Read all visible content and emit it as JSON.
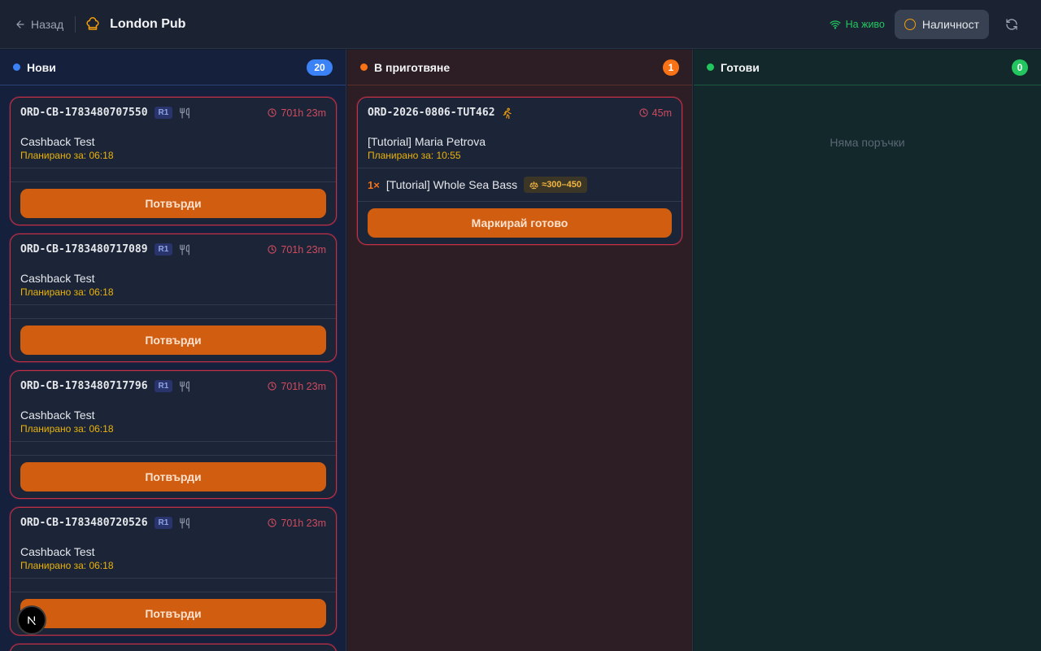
{
  "header": {
    "back_label": "Назад",
    "title": "London Pub",
    "live_label": "На живо",
    "availability_label": "Наличност"
  },
  "colors": {
    "new_dot": "#3b82f6",
    "prep_dot": "#f97316",
    "ready_dot": "#22c55e",
    "accent_button": "#d05d10",
    "urgent_border": "#c53047"
  },
  "columns": {
    "new": {
      "title": "Нови",
      "count": "20",
      "orders": [
        {
          "id": "ORD-CB-1783480707550",
          "branch": "R1",
          "elapsed": "701h 23m",
          "name": "Cashback Test",
          "scheduled": "Планирано за: 06:18",
          "action": "Потвърди"
        },
        {
          "id": "ORD-CB-1783480717089",
          "branch": "R1",
          "elapsed": "701h 23m",
          "name": "Cashback Test",
          "scheduled": "Планирано за: 06:18",
          "action": "Потвърди"
        },
        {
          "id": "ORD-CB-1783480717796",
          "branch": "R1",
          "elapsed": "701h 23m",
          "name": "Cashback Test",
          "scheduled": "Планирано за: 06:18",
          "action": "Потвърди"
        },
        {
          "id": "ORD-CB-1783480720526",
          "branch": "R1",
          "elapsed": "701h 23m",
          "name": "Cashback Test",
          "scheduled": "Планирано за: 06:18",
          "action": "Потвърди"
        }
      ]
    },
    "prep": {
      "title": "В приготвяне",
      "count": "1",
      "orders": [
        {
          "id": "ORD-2026-0806-TUT462",
          "elapsed": "45m",
          "name": "[Tutorial] Maria Petrova",
          "scheduled": "Планирано за: 10:55",
          "item_qty": "1×",
          "item_name": "[Tutorial] Whole Sea Bass",
          "item_weight": "≈300–450",
          "action": "Маркирай готово"
        }
      ]
    },
    "ready": {
      "title": "Готови",
      "count": "0",
      "empty_text": "Няма поръчки"
    }
  },
  "icons": {
    "back": "arrow-left-icon",
    "brand": "chef-hat-icon",
    "live": "wifi-icon",
    "availability": "circle-icon",
    "refresh": "refresh-icon",
    "utensils": "utensils-icon",
    "runner": "runner-icon",
    "timer": "clock-icon",
    "weight": "scale-icon",
    "dev": "nextjs-icon"
  }
}
